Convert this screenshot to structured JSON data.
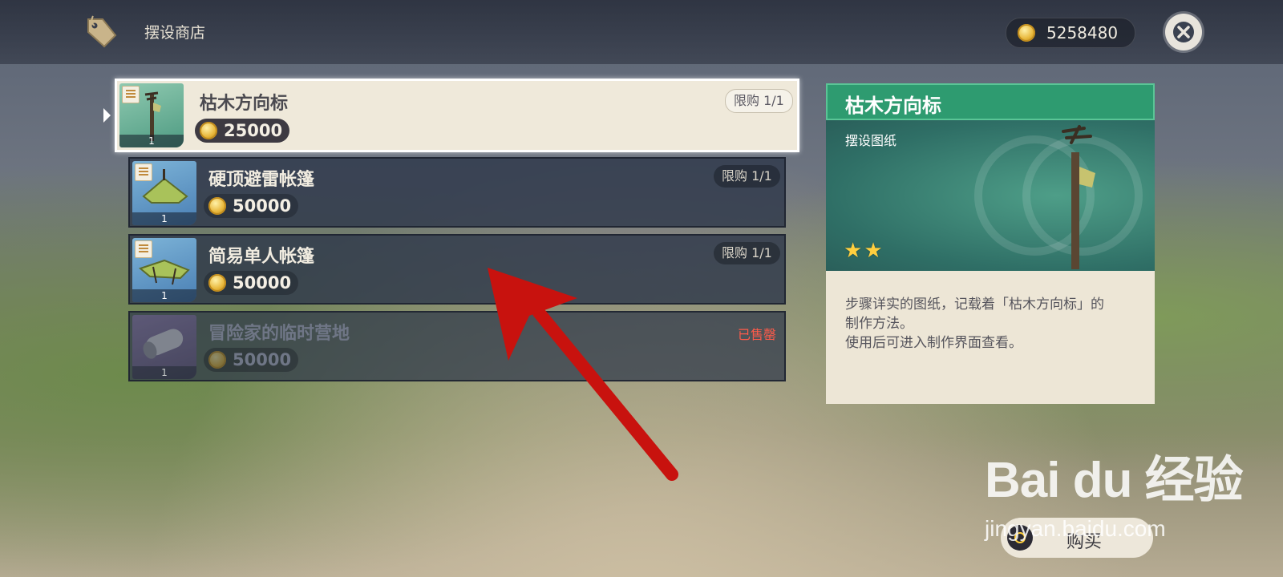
{
  "header": {
    "shop_title": "摆设商店",
    "currency_amount": "5258480",
    "currency_icon": "mora-coin-icon",
    "close_icon": "close-icon"
  },
  "items": [
    {
      "name": "枯木方向标",
      "price": "25000",
      "qty": "1",
      "limit": "限购 1/1",
      "state": "selected"
    },
    {
      "name": "硬顶避雷帐篷",
      "price": "50000",
      "qty": "1",
      "limit": "限购 1/1",
      "state": "normal"
    },
    {
      "name": "简易单人帐篷",
      "price": "50000",
      "qty": "1",
      "limit": "限购 1/1",
      "state": "normal"
    },
    {
      "name": "冒险家的临时营地",
      "price": "50000",
      "qty": "1",
      "sold_label": "已售罄",
      "state": "soldout"
    }
  ],
  "detail": {
    "title": "枯木方向标",
    "type": "摆设图纸",
    "rarity": 2,
    "desc": "步骤详实的图纸，记载着「枯木方向标」的\n制作方法。\n使用后可进入制作界面查看。"
  },
  "buy": {
    "label": "购买"
  },
  "watermark": {
    "brand": "Bai du 经验",
    "url": "jingyan.baidu.com"
  },
  "colors": {
    "accent_green": "#2e9b70",
    "sold_red": "#ff5b4a",
    "star": "#ffcf3f",
    "annotation_arrow": "#c8120e"
  }
}
